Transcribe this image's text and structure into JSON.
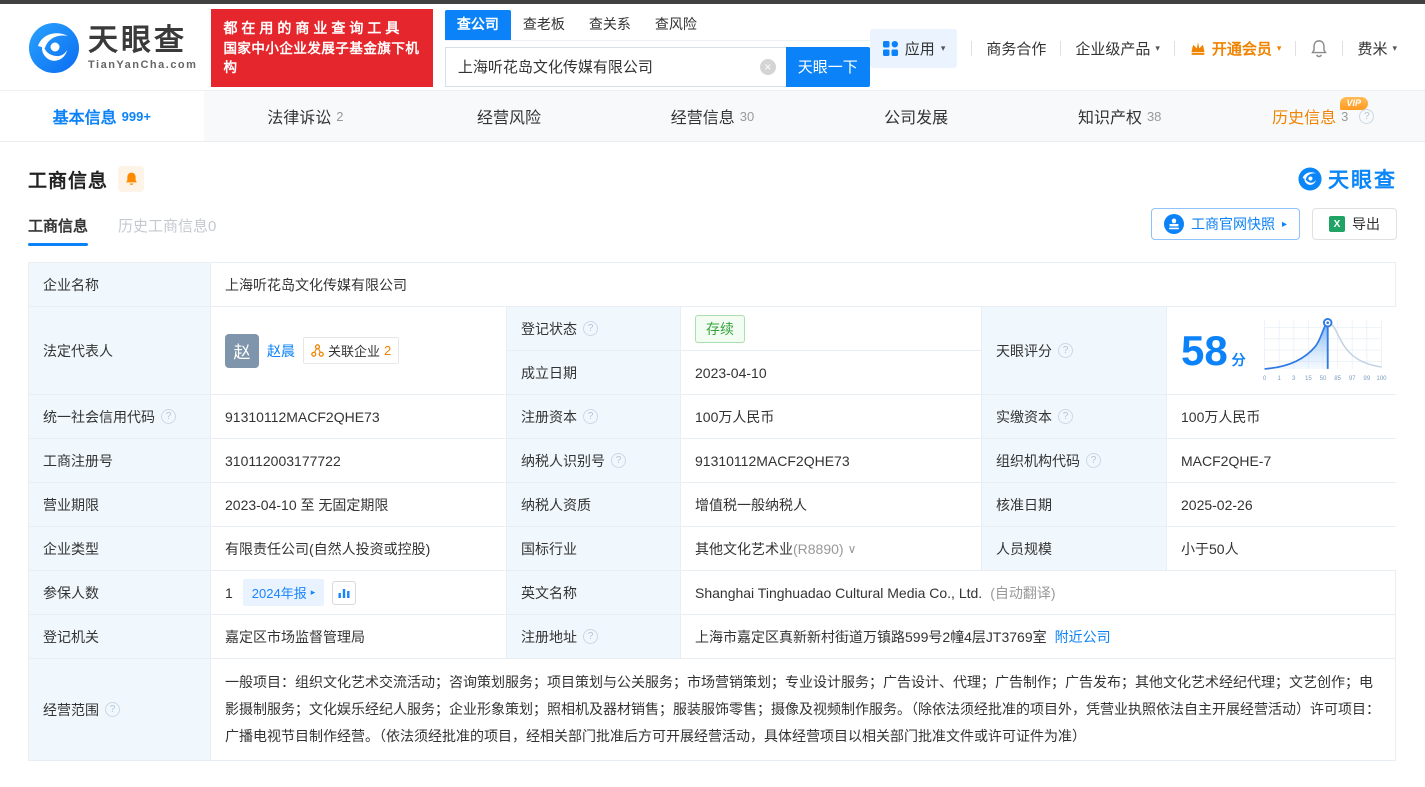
{
  "icons": {
    "help": "?",
    "caret_down": "▾",
    "chevron_down": "∨",
    "arrow_right": "▸",
    "clear": "×"
  },
  "header": {
    "logo": {
      "brand": "天眼查",
      "domain": "TianYanCha.com"
    },
    "banner": {
      "line1": "都在用的商业查询工具",
      "line2": "国家中小企业发展子基金旗下机构"
    },
    "search": {
      "tabs": [
        {
          "label": "查公司"
        },
        {
          "label": "查老板"
        },
        {
          "label": "查关系"
        },
        {
          "label": "查风险"
        }
      ],
      "value": "上海听花岛文化传媒有限公司",
      "button": "天眼一下"
    },
    "nav": {
      "apps": "应用",
      "business_cooperation": "商务合作",
      "enterprise_products": "企业级产品",
      "open_vip": "开通会员",
      "username": "费米"
    }
  },
  "tabs": [
    {
      "label": "基本信息",
      "count": "999+"
    },
    {
      "label": "法律诉讼",
      "count": "2"
    },
    {
      "label": "经营风险",
      "count": ""
    },
    {
      "label": "经营信息",
      "count": "30"
    },
    {
      "label": "公司发展",
      "count": ""
    },
    {
      "label": "知识产权",
      "count": "38"
    },
    {
      "label": "历史信息",
      "count": "3",
      "vip": "VIP"
    }
  ],
  "section": {
    "title": "工商信息",
    "watermark": "天眼查",
    "subtabs": [
      {
        "label": "工商信息"
      },
      {
        "label": "历史工商信息0"
      }
    ],
    "snapshot_button": "工商官网快照",
    "export_button": "导出"
  },
  "table": {
    "company_name_label": "企业名称",
    "company_name": "上海听花岛文化传媒有限公司",
    "legal_rep_label": "法定代表人",
    "legal_rep_avatar": "赵",
    "legal_rep_name": "赵晨",
    "related_companies_label": "关联企业",
    "related_companies_count": "2",
    "reg_status_label": "登记状态",
    "reg_status": "存续",
    "establish_date_label": "成立日期",
    "establish_date": "2023-04-10",
    "score_label": "天眼评分",
    "score_value": "58",
    "score_unit": "分",
    "score_axis": [
      "0",
      "1",
      "3",
      "15",
      "50",
      "85",
      "97",
      "99",
      "100"
    ],
    "rows": [
      {
        "cells": [
          {
            "label": "统一社会信用代码",
            "value": "91310112MACF2QHE73"
          },
          {
            "label": "注册资本",
            "value": "100万人民币"
          },
          {
            "label": "实缴资本",
            "value": "100万人民币"
          }
        ]
      },
      {
        "cells": [
          {
            "label": "工商注册号",
            "value": "310112003177722"
          },
          {
            "label": "纳税人识别号",
            "value": "91310112MACF2QHE73"
          },
          {
            "label": "组织机构代码",
            "value": "MACF2QHE-7"
          }
        ]
      },
      {
        "cells": [
          {
            "label": "营业期限",
            "value": "2023-04-10 至 无固定期限"
          },
          {
            "label": "纳税人资质",
            "value": "增值税一般纳税人"
          },
          {
            "label": "核准日期",
            "value": "2025-02-26"
          }
        ]
      },
      {
        "cells": [
          {
            "label": "企业类型",
            "value": "有限责任公司(自然人投资或控股)"
          },
          {
            "label": "国标行业",
            "value": "其他文化艺术业",
            "value_extra": "(R8890)"
          },
          {
            "label": "人员规模",
            "value": "小于50人"
          }
        ]
      }
    ],
    "insured_label": "参保人数",
    "insured_value": "1",
    "annual_report_badge": "2024年报",
    "english_name_label": "英文名称",
    "english_name": "Shanghai Tinghuadao Cultural Media Co., Ltd.",
    "english_name_note": "(自动翻译)",
    "reg_authority_label": "登记机关",
    "reg_authority": "嘉定区市场监督管理局",
    "reg_address_label": "注册地址",
    "reg_address": "上海市嘉定区真新新村街道万镇路599号2幢4层JT3769室",
    "nearby_link": "附近公司",
    "business_scope_label": "经营范围",
    "business_scope": "一般项目：组织文化艺术交流活动；咨询策划服务；项目策划与公关服务；市场营销策划；专业设计服务；广告设计、代理；广告制作；广告发布；其他文化艺术经纪代理；文艺创作；电影摄制服务；文化娱乐经纪人服务；企业形象策划；照相机及器材销售；服装服饰零售；摄像及视频制作服务。（除依法须经批准的项目外，凭营业执照依法自主开展经营活动）许可项目：广播电视节目制作经营。（依法须经批准的项目，经相关部门批准后方可开展经营活动，具体经营项目以相关部门批准文件或许可证件为准）"
  }
}
